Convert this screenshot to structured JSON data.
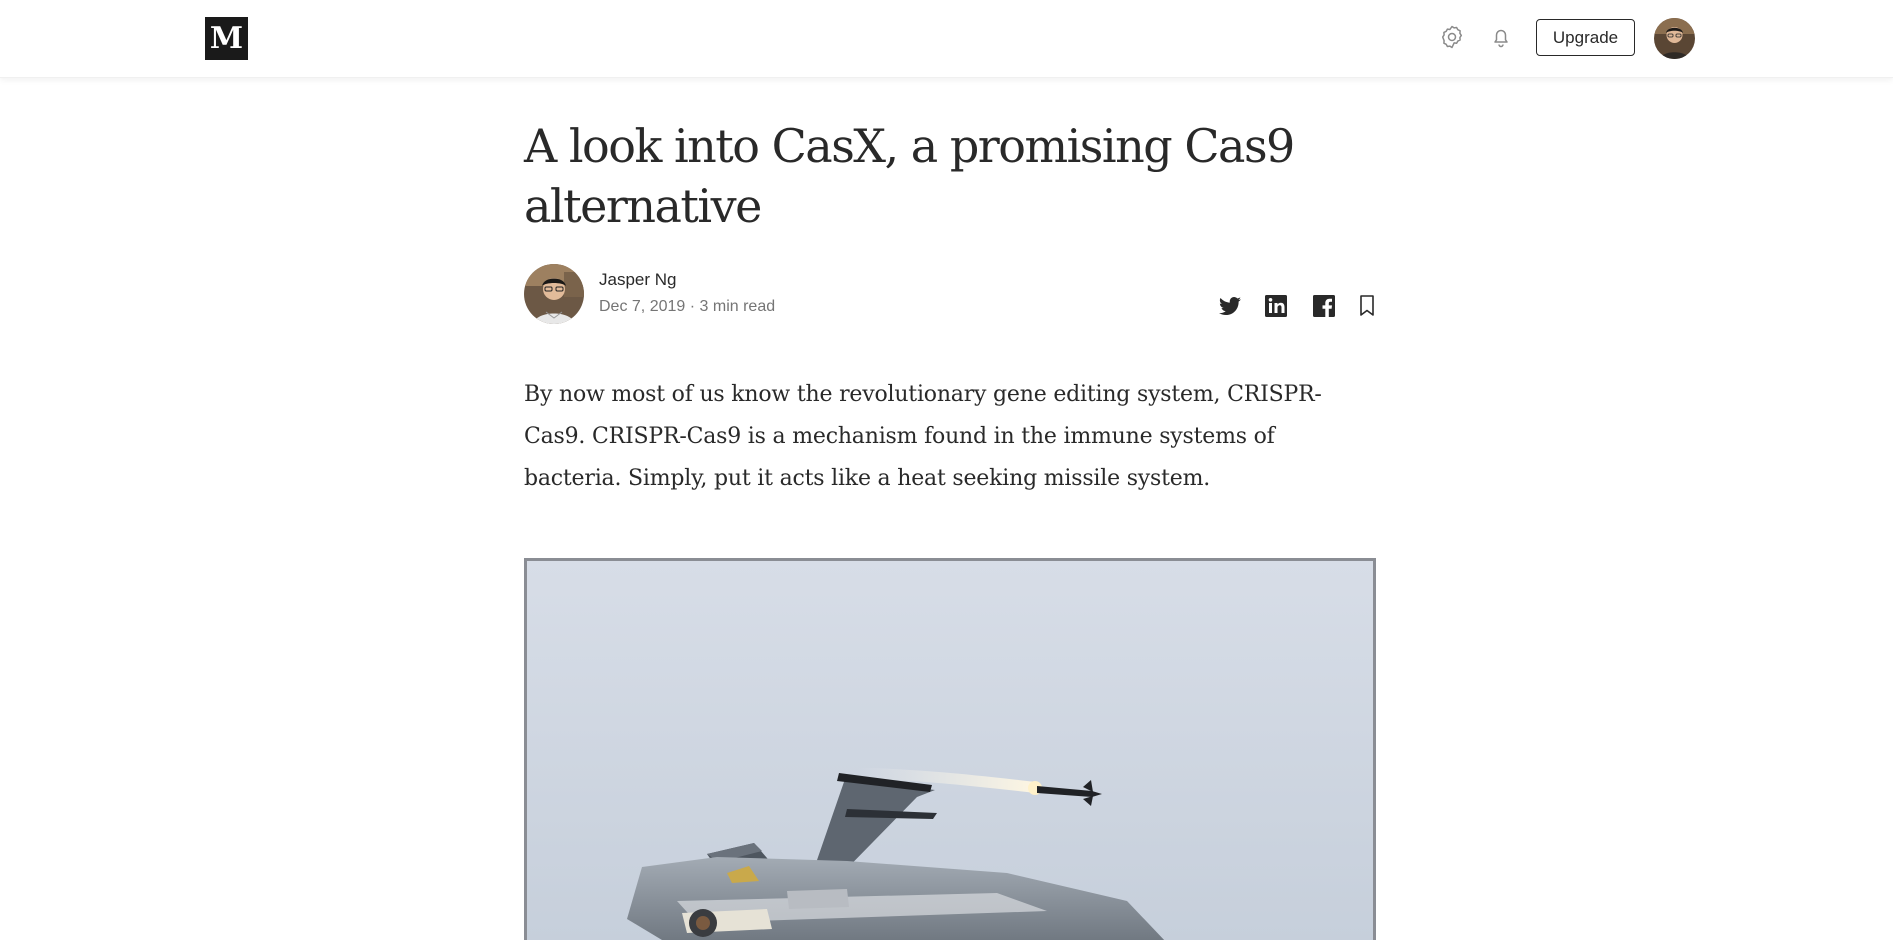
{
  "header": {
    "logo_letter": "M",
    "settings_icon": "gear-icon",
    "notifications_icon": "bell-icon",
    "upgrade_label": "Upgrade",
    "avatar_icon": "user-avatar"
  },
  "article": {
    "title": "A look into CasX, a promising Cas9 alternative",
    "author": "Jasper Ng",
    "date": "Dec 7, 2019",
    "separator": "·",
    "read_time": "3 min read",
    "share_icons": [
      "twitter-icon",
      "linkedin-icon",
      "facebook-icon",
      "bookmark-icon"
    ],
    "intro": "By now most of us know the revolutionary gene editing system, CRISPR-Cas9. CRISPR-Cas9 is a mechanism found in the immune systems of bacteria. Simply, put it acts like a heat seeking missile system.",
    "hero_image_description": "fighter-jet-firing-missile"
  },
  "colors": {
    "text": "#292929",
    "muted": "#757575",
    "logo_bg": "#1a1a1a",
    "image_border": "#8a8d94"
  }
}
